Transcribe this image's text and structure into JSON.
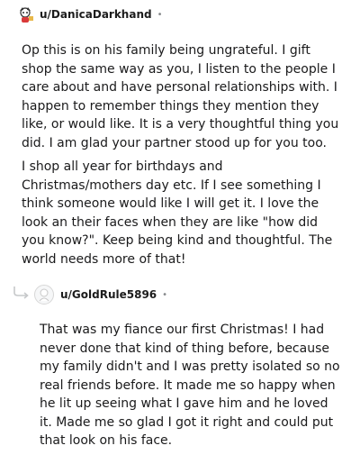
{
  "comment1": {
    "username": "u/DanicaDarkhand",
    "separator": "•",
    "paragraphs": [
      "Op this is on his family being ungrateful. I gift shop the same way as you, I listen to the people I care about and have personal relationships with. I happen to remember things they mention they like, or would like. It is a very thoughtful thing you did. I am glad your partner stood up for you too.",
      "I shop all year for birthdays and Christmas/mothers day etc. If I see something I think someone would like I will get it. I love the look an their faces when they are like \"how did you know?\". Keep being kind and thoughtful. The world needs more of that!"
    ]
  },
  "comment2": {
    "username": "u/GoldRule5896",
    "separator": "•",
    "paragraphs": [
      "That was my fiance our first Christmas! I had never done that kind of thing before, because my family didn't and I was pretty isolated so no real friends before. It made me so happy when he lit up seeing what I gave him and he loved it. Made me so glad I got it right and could put that look on his face."
    ]
  },
  "icons": {
    "avatar1": "cartoon-avatar-icon",
    "avatar2": "default-avatar-icon",
    "reply": "reply-arrow-icon"
  }
}
